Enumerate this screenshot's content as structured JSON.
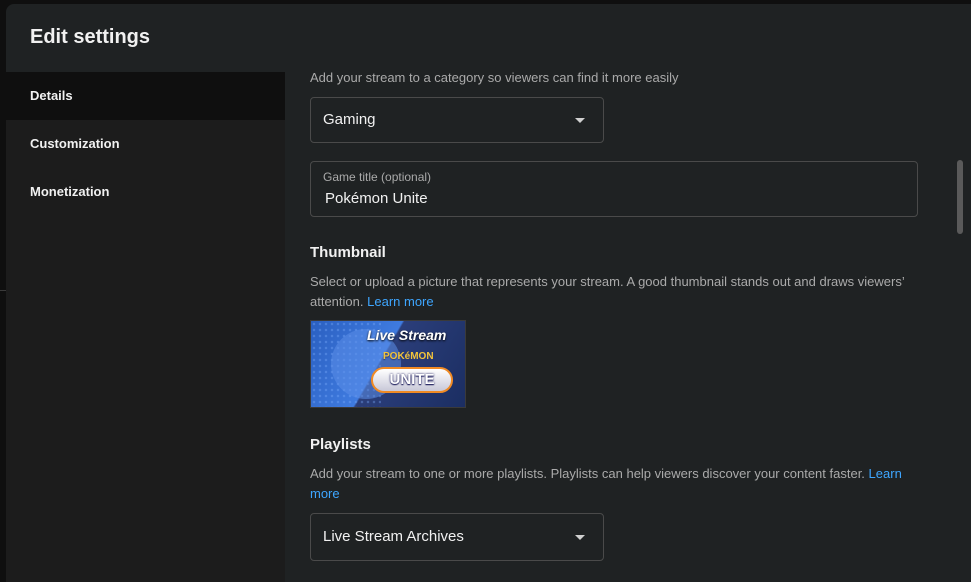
{
  "dialog": {
    "title": "Edit settings"
  },
  "sidebar": {
    "items": [
      {
        "label": "Details",
        "active": true
      },
      {
        "label": "Customization",
        "active": false
      },
      {
        "label": "Monetization",
        "active": false
      }
    ]
  },
  "category": {
    "hint": "Add your stream to a category so viewers can find it more easily",
    "selected": "Gaming"
  },
  "game_title": {
    "label": "Game title (optional)",
    "value": "Pokémon Unite"
  },
  "thumbnail": {
    "heading": "Thumbnail",
    "description": "Select or upload a picture that represents your stream. A good thumbnail stands out and draws viewers’ attention.",
    "learn_more": "Learn more",
    "image_caption": "Live Stream",
    "logo_top": "POKéMON",
    "logo_main": "UNITE"
  },
  "playlists": {
    "heading": "Playlists",
    "description": "Add your stream to one or more playlists. Playlists can help viewers discover your content faster.",
    "learn_more": "Learn more",
    "selected": "Live Stream Archives"
  },
  "colors": {
    "accent": "#3ea6ff",
    "dialog_bg": "#1f2223",
    "sidebar_active": "#0f0f0f"
  }
}
